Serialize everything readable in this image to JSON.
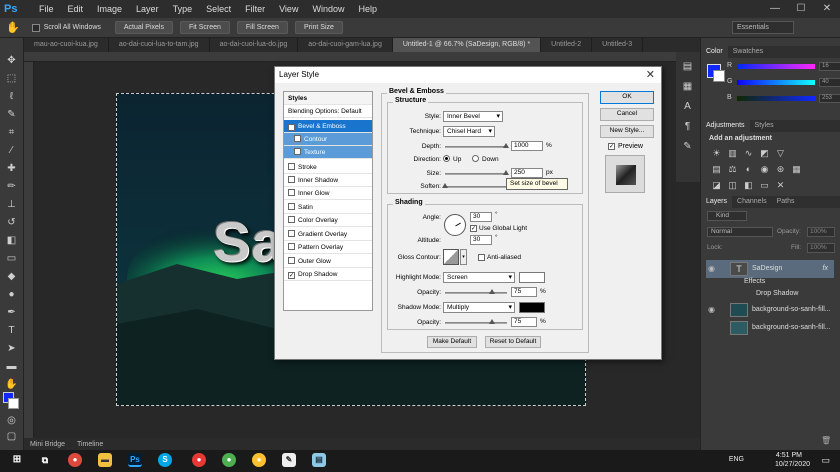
{
  "app": {
    "logo": "Ps",
    "accent": "#31a8ff"
  },
  "menu": [
    "File",
    "Edit",
    "Image",
    "Layer",
    "Type",
    "Select",
    "Filter",
    "View",
    "Window",
    "Help"
  ],
  "window_controls": [
    "—",
    "☐",
    "✕"
  ],
  "options_bar": {
    "scroll_all_windows": "Scroll All Windows",
    "buttons": [
      "Actual Pixels",
      "Fit Screen",
      "Fill Screen",
      "Print Size"
    ],
    "workspace": "Essentials"
  },
  "tabs": [
    {
      "label": "mau-ao-cuoi-kua.jpg",
      "active": false
    },
    {
      "label": "ao-dai-cuoi-lua-to-tam.jpg",
      "active": false
    },
    {
      "label": "ao-dai-cuoi-lua-do.jpg",
      "active": false
    },
    {
      "label": "ao-dai-cuoi-gam-lua.jpg",
      "active": false
    },
    {
      "label": "Untitled-1 @ 66.7% (SaDesign, RGB/8) *",
      "active": true
    },
    {
      "label": "Untitled-2",
      "active": false
    },
    {
      "label": "Untitled-3",
      "active": false
    }
  ],
  "canvas": {
    "text": "Sa"
  },
  "bottom_tabs": [
    "Mini Bridge",
    "Timeline"
  ],
  "dialog": {
    "title": "Layer Style",
    "styles_header": "Styles",
    "blending_options": "Blending Options: Default",
    "items": [
      {
        "label": "Bevel & Emboss",
        "checked": true,
        "state": "selected"
      },
      {
        "label": "Contour",
        "checked": false,
        "state": "sub"
      },
      {
        "label": "Texture",
        "checked": false,
        "state": "sub"
      },
      {
        "label": "Stroke",
        "checked": false,
        "state": ""
      },
      {
        "label": "Inner Shadow",
        "checked": false,
        "state": ""
      },
      {
        "label": "Inner Glow",
        "checked": false,
        "state": ""
      },
      {
        "label": "Satin",
        "checked": false,
        "state": ""
      },
      {
        "label": "Color Overlay",
        "checked": false,
        "state": ""
      },
      {
        "label": "Gradient Overlay",
        "checked": false,
        "state": ""
      },
      {
        "label": "Pattern Overlay",
        "checked": false,
        "state": ""
      },
      {
        "label": "Outer Glow",
        "checked": false,
        "state": ""
      },
      {
        "label": "Drop Shadow",
        "checked": true,
        "state": ""
      }
    ],
    "section_title": "Bevel & Emboss",
    "structure": {
      "title": "Structure",
      "style_label": "Style:",
      "style_value": "Inner Bevel",
      "technique_label": "Technique:",
      "technique_value": "Chisel Hard",
      "depth_label": "Depth:",
      "depth_value": "1000",
      "depth_unit": "%",
      "depth_level": 0.98,
      "direction_label": "Direction:",
      "direction_up": "Up",
      "direction_down": "Down",
      "size_label": "Size:",
      "size_value": "250",
      "size_unit": "px",
      "size_level": 0.98,
      "soften_label": "Soften:",
      "soften_level": 0.0,
      "tooltip": "Set size of bevel"
    },
    "shading": {
      "title": "Shading",
      "angle_label": "Angle:",
      "angle_value": "30",
      "angle_unit": "°",
      "use_global_light": "Use Global Light",
      "altitude_label": "Altitude:",
      "altitude_value": "30",
      "altitude_unit": "°",
      "gloss_label": "Gloss Contour:",
      "anti_aliased": "Anti-aliased",
      "highlight_mode_label": "Highlight Mode:",
      "highlight_mode": "Screen",
      "highlight_color": "#ffffff",
      "opacity_label": "Opacity:",
      "highlight_opacity": "75",
      "opacity_unit": "%",
      "highlight_opacity_level": 0.75,
      "shadow_mode_label": "Shadow Mode:",
      "shadow_mode": "Multiply",
      "shadow_color": "#000000",
      "shadow_opacity": "75",
      "shadow_opacity_level": 0.75
    },
    "make_default": "Make Default",
    "reset_default": "Reset to Default",
    "buttons": {
      "ok": "OK",
      "cancel": "Cancel",
      "new_style": "New Style...",
      "preview": "Preview"
    }
  },
  "color_panel": {
    "tabs": [
      "Color",
      "Swatches"
    ],
    "rows": [
      {
        "label": "R",
        "value": "16"
      },
      {
        "label": "G",
        "value": "40"
      },
      {
        "label": "B",
        "value": "253"
      }
    ],
    "fg": "#1028fd",
    "bg": "#ffffff"
  },
  "adjustments": {
    "tabs": [
      "Adjustments",
      "Styles"
    ],
    "title": "Add an adjustment"
  },
  "layers_panel": {
    "tabs": [
      "Layers",
      "Channels",
      "Paths"
    ],
    "filter": "Kind",
    "blend_mode": "Normal",
    "opacity_label": "Opacity:",
    "opacity_value": "100%",
    "lock_label": "Lock:",
    "fill_label": "Fill:",
    "fill_value": "100%",
    "layers": [
      {
        "name": "SaDesign",
        "type": "text",
        "fx": "fx"
      },
      {
        "name": "Effects",
        "type": "sub"
      },
      {
        "name": "Drop Shadow",
        "type": "subsub"
      },
      {
        "name": "background-so-sanh-fill...",
        "type": "image"
      },
      {
        "name": "background-so-sanh-fill...",
        "type": "image"
      }
    ]
  },
  "taskbar": {
    "time": "4:51 PM",
    "date": "10/27/2020",
    "lang": "ENG"
  }
}
